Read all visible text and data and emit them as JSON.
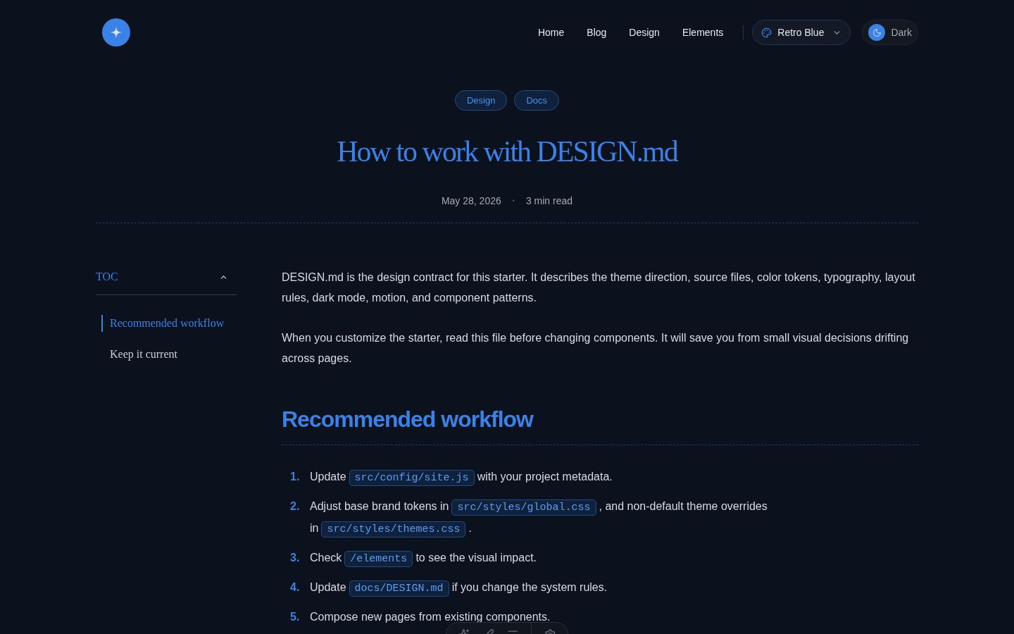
{
  "nav": {
    "links": [
      {
        "label": "Home"
      },
      {
        "label": "Blog"
      },
      {
        "label": "Design"
      },
      {
        "label": "Elements"
      }
    ],
    "theme_select": {
      "value": "Retro Blue"
    },
    "mode_toggle": {
      "label": "Dark",
      "on": true
    }
  },
  "tags": [
    "Design",
    "Docs"
  ],
  "title": "How to work with DESIGN.md",
  "meta": {
    "date": "May 28, 2026",
    "separator": "•",
    "read_time": "3 min read"
  },
  "toc": {
    "title": "TOC",
    "expanded": true,
    "items": [
      {
        "label": "Recommended workflow",
        "selected": true
      },
      {
        "label": "Keep it current",
        "selected": false
      }
    ]
  },
  "intro": [
    "DESIGN.md is the design contract for this starter. It describes the theme direction, source files, color tokens, typography, layout rules, dark mode, motion, and component patterns.",
    "When you customize the starter, read this file before changing components. It will save you from small visual decisions drifting across pages."
  ],
  "section": {
    "heading": "Recommended workflow",
    "steps": [
      {
        "number": "1.",
        "parts": [
          {
            "kind": "text",
            "text": "Update"
          },
          {
            "kind": "code",
            "text": "src/config/site.js"
          },
          {
            "kind": "text",
            "text": "with your project metadata."
          }
        ]
      },
      {
        "number": "2.",
        "parts": [
          {
            "kind": "text",
            "text": "Adjust base brand tokens in"
          },
          {
            "kind": "code",
            "text": "src/styles/global.css"
          },
          {
            "kind": "text",
            "text": ", and non-default theme overrides in"
          },
          {
            "kind": "code",
            "text": "src/styles/themes.css"
          },
          {
            "kind": "text",
            "text": "."
          }
        ]
      },
      {
        "number": "3.",
        "parts": [
          {
            "kind": "text",
            "text": "Check"
          },
          {
            "kind": "code",
            "text": "/elements"
          },
          {
            "kind": "text",
            "text": "to see the visual impact."
          }
        ]
      },
      {
        "number": "4.",
        "parts": [
          {
            "kind": "text",
            "text": "Update"
          },
          {
            "kind": "code",
            "text": "docs/DESIGN.md"
          },
          {
            "kind": "text",
            "text": "if you change the system rules."
          }
        ]
      },
      {
        "number": "5.",
        "parts": [
          {
            "kind": "text",
            "text": "Compose new pages from existing components."
          }
        ]
      }
    ]
  }
}
